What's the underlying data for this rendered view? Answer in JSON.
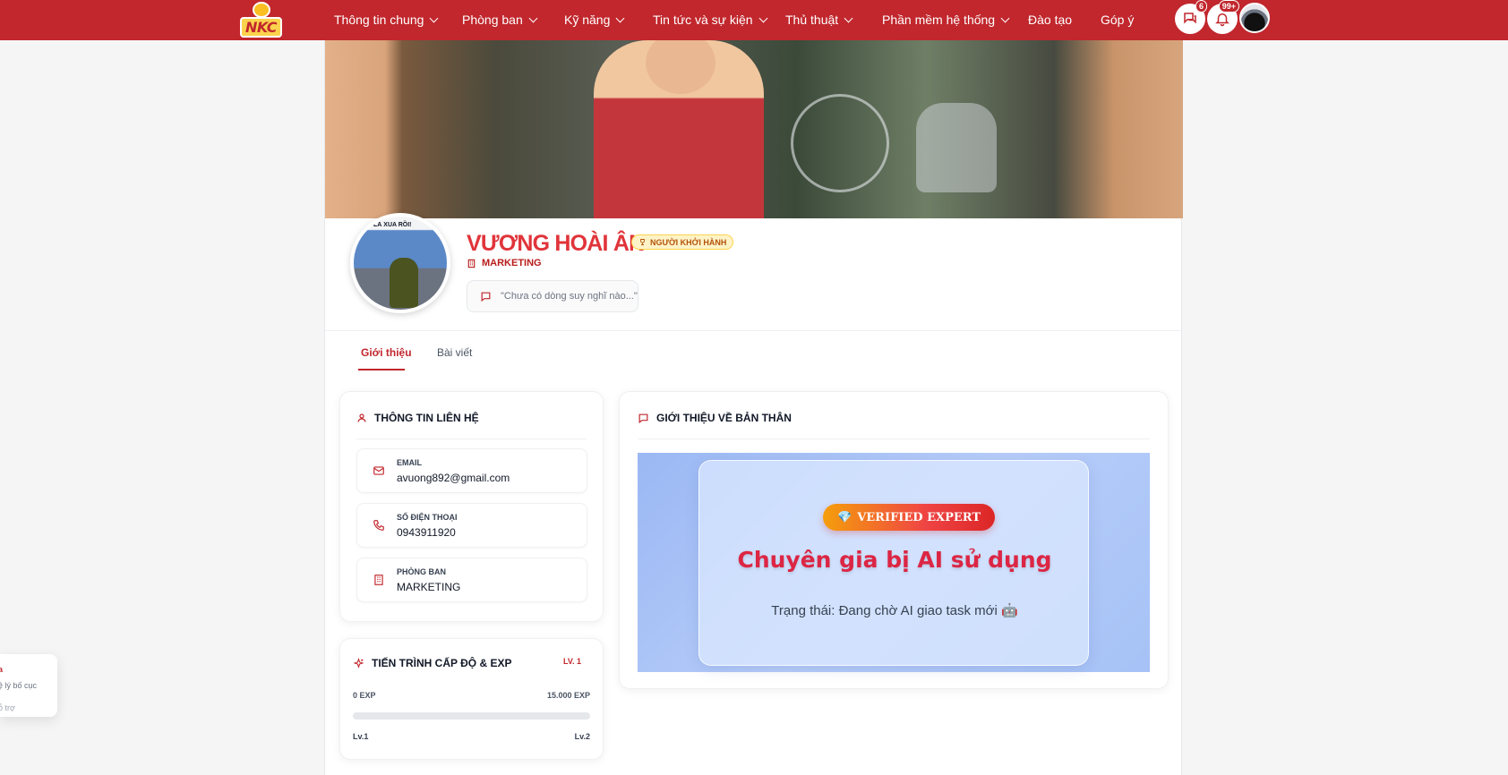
{
  "nav": {
    "logo_text": "NKC",
    "items": [
      {
        "label": "Thông tin chung",
        "dropdown": true
      },
      {
        "label": "Phòng ban",
        "dropdown": true
      },
      {
        "label": "Kỹ năng",
        "dropdown": true
      },
      {
        "label": "Tin tức và sự kiện",
        "dropdown": true
      },
      {
        "label": "Thủ thuật",
        "dropdown": true
      },
      {
        "label": "Phần mềm hệ thống",
        "dropdown": true
      },
      {
        "label": "Đào tạo",
        "dropdown": false
      },
      {
        "label": "Góp ý",
        "dropdown": false
      }
    ],
    "messages_badge": "6",
    "notifications_badge": "99+",
    "icons": {
      "messages": "chat-icon",
      "notifications": "bell-icon"
    }
  },
  "profile": {
    "avatar_caption": "LÀ XUA RỒI!",
    "name": "VƯƠNG HOÀI ÂN",
    "rank_badge": "NGƯỜI KHỞI HÀNH",
    "department": "MARKETING",
    "thought_placeholder": "\"Chưa có dòng suy nghĩ nào...\""
  },
  "tabs": [
    {
      "label": "Giới thiệu",
      "active": true
    },
    {
      "label": "Bài viết",
      "active": false
    }
  ],
  "contact": {
    "title": "THÔNG TIN LIÊN HỆ",
    "rows": [
      {
        "label": "EMAIL",
        "value": "avuong892@gmail.com",
        "icon": "mail-icon"
      },
      {
        "label": "SỐ ĐIỆN THOẠI",
        "value": "0943911920",
        "icon": "phone-icon"
      },
      {
        "label": "PHÒNG BAN",
        "value": "MARKETING",
        "icon": "building-icon"
      }
    ]
  },
  "progress": {
    "title": "TIẾN TRÌNH CẤP ĐỘ & EXP",
    "level_tag": "LV. 1",
    "exp_start": "0 EXP",
    "exp_end": "15.000 EXP",
    "fill_fraction": 0,
    "current_level": "Lv.1",
    "next_level": "Lv.2"
  },
  "intro": {
    "title": "GIỚI THIỆU VỀ BẢN THÂN",
    "badge": "VERIFIED EXPERT",
    "headline": "Chuyên gia bị AI sử dụng",
    "status": "Trạng thái: Đang chờ AI giao task mới 🤖"
  },
  "toast": {
    "line1": "a",
    "line2": "ệ lý bố cục",
    "line3": "ỗ trợ"
  },
  "colors": {
    "brand": "#c1272d",
    "name": "#e0343a",
    "headline": "#dc2644"
  }
}
